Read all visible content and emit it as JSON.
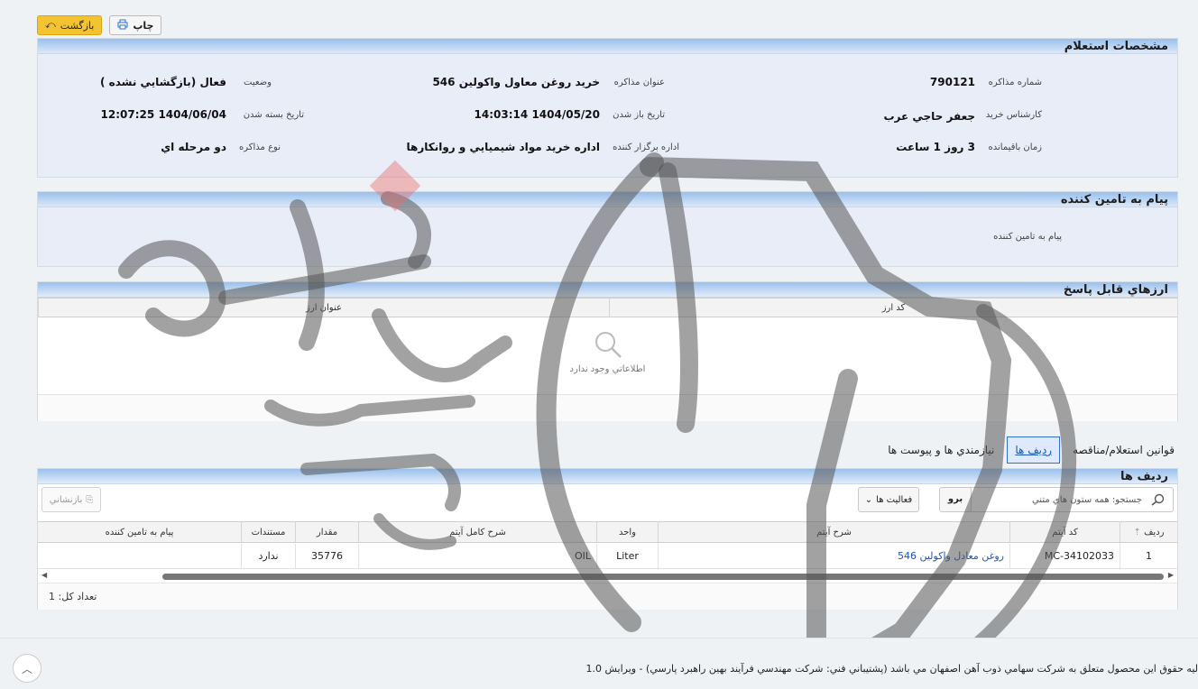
{
  "toolbar": {
    "back_label": "بازگشت",
    "print_label": "چاپ"
  },
  "specs": {
    "title": "مشخصات استعلام",
    "fields": [
      {
        "label": "شماره مذاکره",
        "value": "790121"
      },
      {
        "label": "عنوان مذاکره",
        "value": "خريد روغن معاول واكولين 546"
      },
      {
        "label": "وضعيت",
        "value": "فعال (بازگشايي نشده )"
      },
      {
        "label": "کارشناس خريد",
        "value": "جعفر حاجي عرب"
      },
      {
        "label": "تاريخ باز شدن",
        "value": "1404/05/20 14:03:14"
      },
      {
        "label": "تاريخ بسته شدن",
        "value": "1404/06/04 12:07:25"
      },
      {
        "label": "زمان باقيمانده",
        "value": "3 روز 1 ساعت"
      },
      {
        "label": "اداره برگزار کننده",
        "value": "اداره خريد مواد شيميايي و روانكارها"
      },
      {
        "label": "نوع مذاکره",
        "value": "دو مرحله اي"
      }
    ]
  },
  "message": {
    "title": "پيام به تامين کننده",
    "label": "پيام به تامين کننده"
  },
  "currencies": {
    "title": "ارزهاي قابل پاسخ",
    "columns": [
      "کد ارز",
      "عنوان ارز"
    ],
    "empty_text": "اطلاعاتي وجود ندارد"
  },
  "tabs": [
    "نيازمندي ها و پيوست ها",
    "رديف ها",
    "قوانين استعلام/مناقصه"
  ],
  "rows": {
    "title": "رديف ها",
    "search_placeholder": "جستجو: همه ستون هاي متني",
    "search_mode": "برو",
    "activities_label": "فعاليت ها",
    "reset_label": "بازنشاني",
    "columns": [
      "رديف",
      "کد آيتم",
      "شرح آيتم",
      "واحد",
      "شرح کامل آيتم",
      "مقدار",
      "مستندات",
      "پيام به تامين کننده"
    ],
    "items": [
      {
        "idx": "1",
        "code": "MC-34102033",
        "desc": "روغن معادل واكولين 546",
        "unit": "Liter",
        "full_desc": "OIL",
        "qty": "35776",
        "docs": "ندارد",
        "msg": ""
      }
    ],
    "total": "تعداد کل: 1"
  },
  "footer": {
    "text": "ليه حقوق اين محصول متعلق به شرکت سهامي ذوب آهن اصفهان مي باشد (پشتيباني فني: شرکت مهندسي فرآيند بهين راهبرد پارسي) - ويرايش 1.0"
  },
  "colors": {
    "accent": "#2d6fd3",
    "panel_head": "#9ac0ec",
    "back_button": "#f4c430"
  }
}
